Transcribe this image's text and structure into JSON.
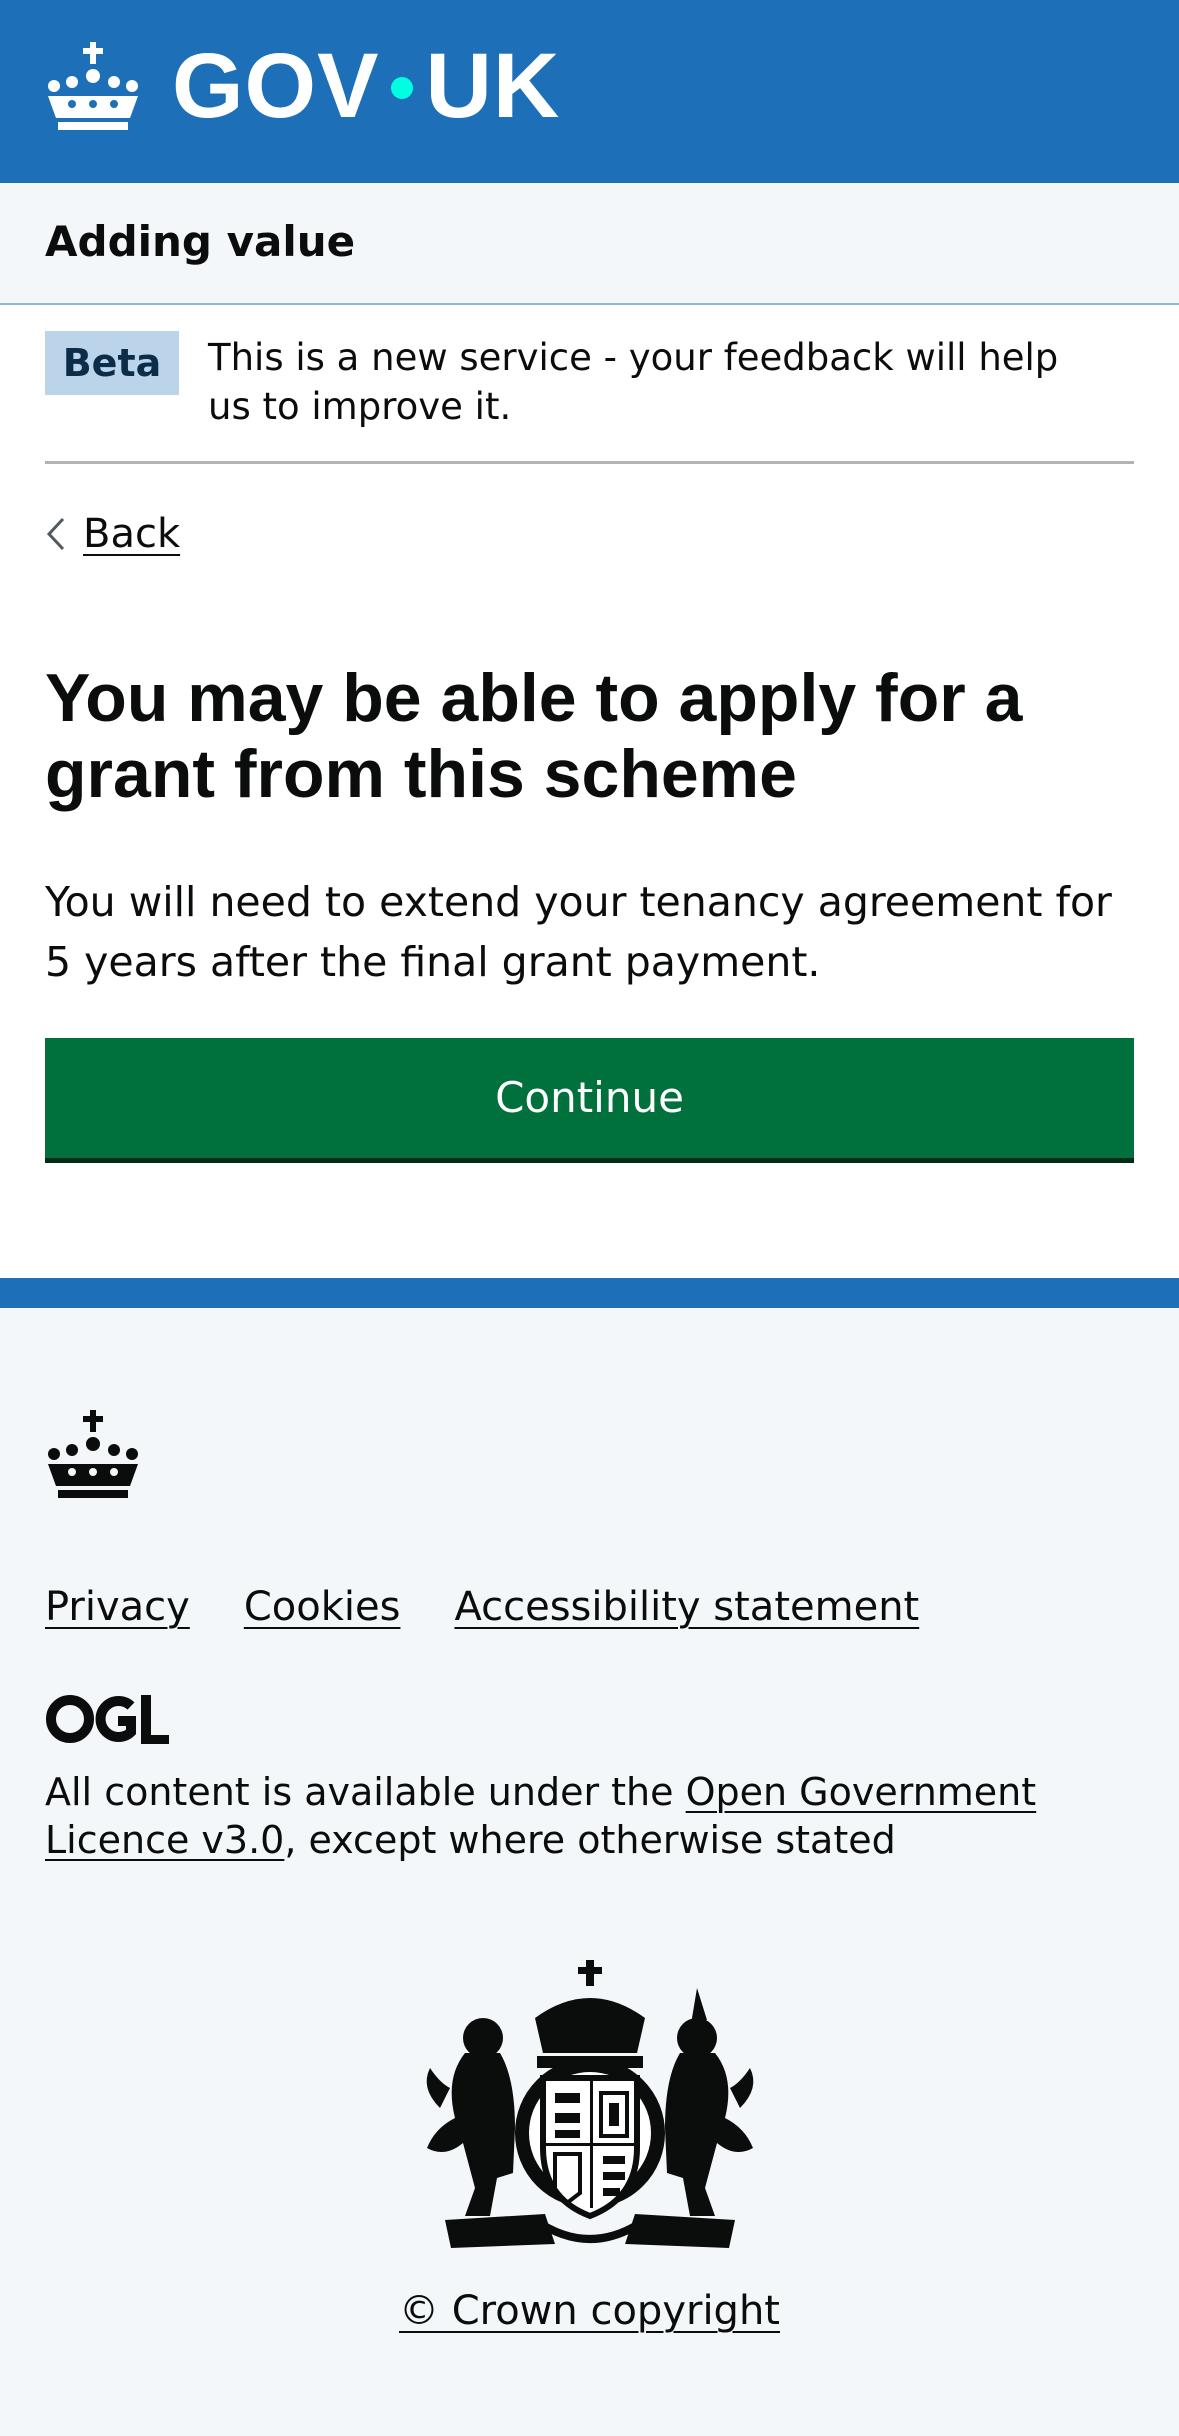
{
  "header": {
    "logo_left": "GOV",
    "logo_right": "UK",
    "logo_icon": "crown-icon",
    "brand_color": "#1d70b8",
    "dot_color": "#00ffe0"
  },
  "service": {
    "name": "Adding value"
  },
  "phase_banner": {
    "tag": "Beta",
    "text": "This is a new service - your feedback will help us to improve it."
  },
  "back": {
    "label": "Back",
    "icon": "chevron-left-icon"
  },
  "main": {
    "title": "You may be able to apply for a grant from this scheme",
    "body": "You will need to extend your tenancy agreement for 5 years after the final grant payment.",
    "continue_label": "Continue",
    "button_color": "#00703c"
  },
  "footer": {
    "links": [
      "Privacy",
      "Cookies",
      "Accessibility statement"
    ],
    "ogl_logo": "OGL",
    "licence_prefix": "All content is available under the ",
    "licence_link": "Open Government Licence v3.0",
    "licence_suffix": ", except where otherwise stated",
    "arms_icon": "royal-coat-of-arms-icon",
    "copyright": "© Crown copyright"
  }
}
